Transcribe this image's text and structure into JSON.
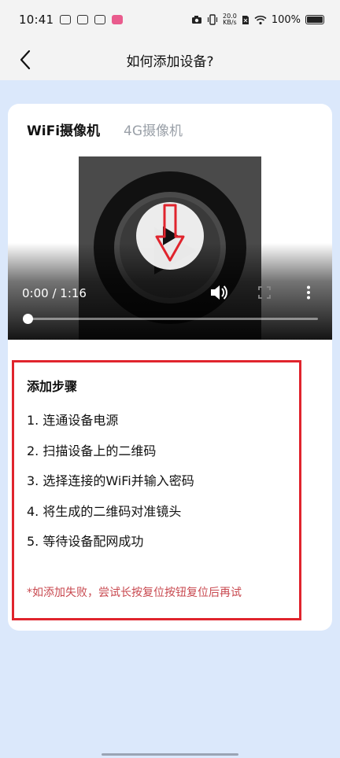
{
  "status_bar": {
    "time": "10:41",
    "net_speed_value": "20.0",
    "net_speed_unit": "KB/s",
    "battery_pct": "100%",
    "icons": [
      "notification-app-icon",
      "notification-app-icon",
      "notification-app-icon",
      "notification-app-icon",
      "camera-icon",
      "vibrate-icon",
      "sim-icon",
      "wifi-icon",
      "battery-icon"
    ]
  },
  "header": {
    "title": "如何添加设备?",
    "back_icon": "chevron-left-icon"
  },
  "tabs": [
    {
      "label": "WiFi摄像机",
      "active": true
    },
    {
      "label": "4G摄像机",
      "active": false
    }
  ],
  "video": {
    "time_display": "0:00 / 1:16",
    "progress": 0,
    "controls": [
      "play-icon",
      "volume-icon",
      "fullscreen-icon",
      "more-vertical-icon"
    ]
  },
  "steps": {
    "title": "添加步骤",
    "items": [
      "1. 连通设备电源",
      "2. 扫描设备上的二维码",
      "3. 选择连接的WiFi并输入密码",
      "4. 将生成的二维码对准镜头",
      "5. 等待设备配网成功"
    ],
    "note": "*如添加失败，尝试长按复位按钮复位后再试"
  },
  "colors": {
    "accent_red": "#e0242d",
    "note_red": "#c8484f",
    "page_blue": "#dbe8fb"
  }
}
